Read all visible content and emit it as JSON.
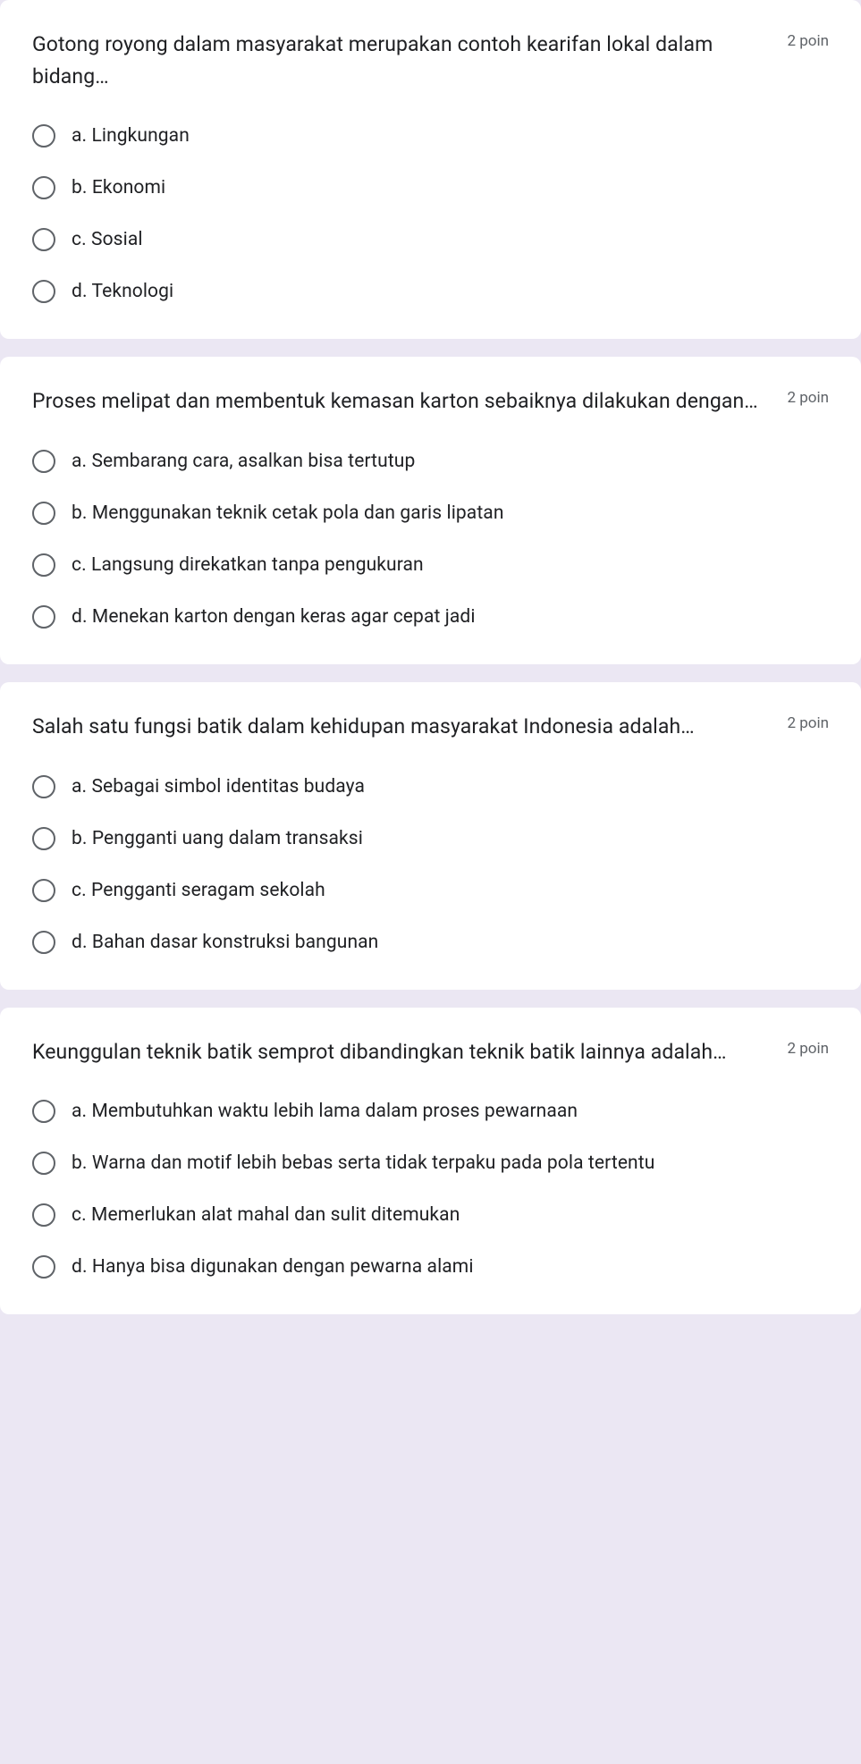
{
  "questions": [
    {
      "text": "Gotong royong dalam masyarakat merupakan contoh kearifan lokal dalam bidang…",
      "points": "2 poin",
      "options": [
        "a. Lingkungan",
        "b. Ekonomi",
        "c. Sosial",
        "d. Teknologi"
      ]
    },
    {
      "text": "Proses melipat dan membentuk kemasan karton sebaiknya dilakukan dengan…",
      "points": "2 poin",
      "options": [
        "a. Sembarang cara, asalkan bisa tertutup",
        "b. Menggunakan teknik cetak pola dan garis lipatan",
        "c. Langsung direkatkan tanpa pengukuran",
        "d. Menekan karton dengan keras agar cepat jadi"
      ]
    },
    {
      "text": "Salah satu fungsi batik dalam kehidupan masyarakat Indonesia adalah…",
      "points": "2 poin",
      "options": [
        "a. Sebagai simbol identitas budaya",
        "b. Pengganti uang dalam transaksi",
        "c. Pengganti seragam sekolah",
        "d. Bahan dasar konstruksi bangunan"
      ]
    },
    {
      "text": "Keunggulan teknik batik semprot dibandingkan teknik batik lainnya adalah…",
      "points": "2 poin",
      "options": [
        "a. Membutuhkan waktu lebih lama dalam proses pewarnaan",
        "b. Warna dan motif lebih bebas serta tidak terpaku pada pola tertentu",
        "c. Memerlukan alat mahal dan sulit ditemukan",
        "d. Hanya bisa digunakan dengan pewarna alami"
      ]
    }
  ]
}
